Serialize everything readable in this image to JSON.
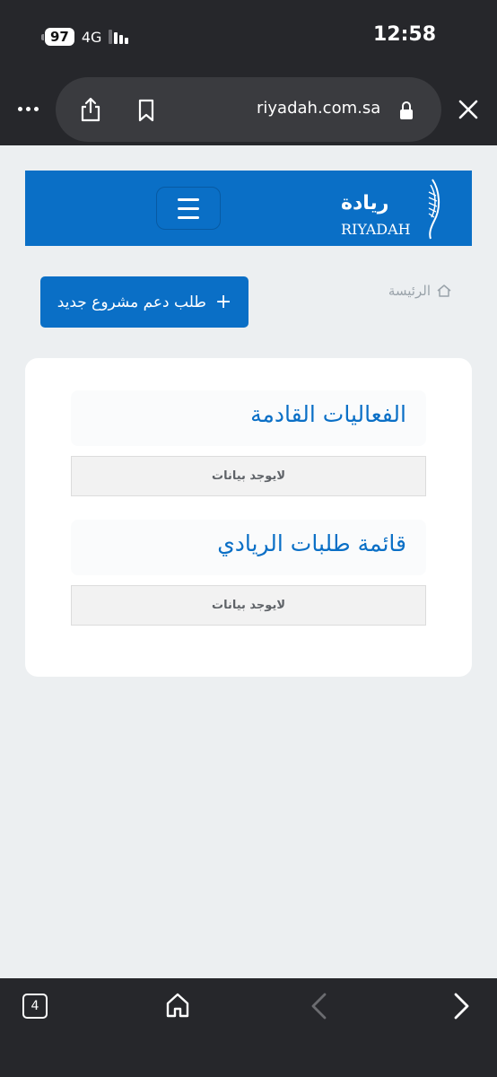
{
  "status_bar": {
    "battery": "97",
    "network": "4G",
    "time": "12:58"
  },
  "browser": {
    "url": "riyadah.com.sa",
    "tab_count": "4"
  },
  "header": {
    "logo_ar": "ريادة",
    "logo_en": "RIYADAH"
  },
  "actions": {
    "new_project_label": "طلب دعم مشروع جديد",
    "plus": "+"
  },
  "breadcrumb": {
    "home_label": "الرئيسة"
  },
  "sections": [
    {
      "title": "الفعاليات القادمة",
      "empty_text": "لايوجد بيانات"
    },
    {
      "title": "قائمة طلبات الريادي",
      "empty_text": "لايوجد بيانات"
    }
  ],
  "colors": {
    "brand": "#0a6fc6",
    "page_bg": "#eceff1",
    "chrome": "#26272b"
  }
}
